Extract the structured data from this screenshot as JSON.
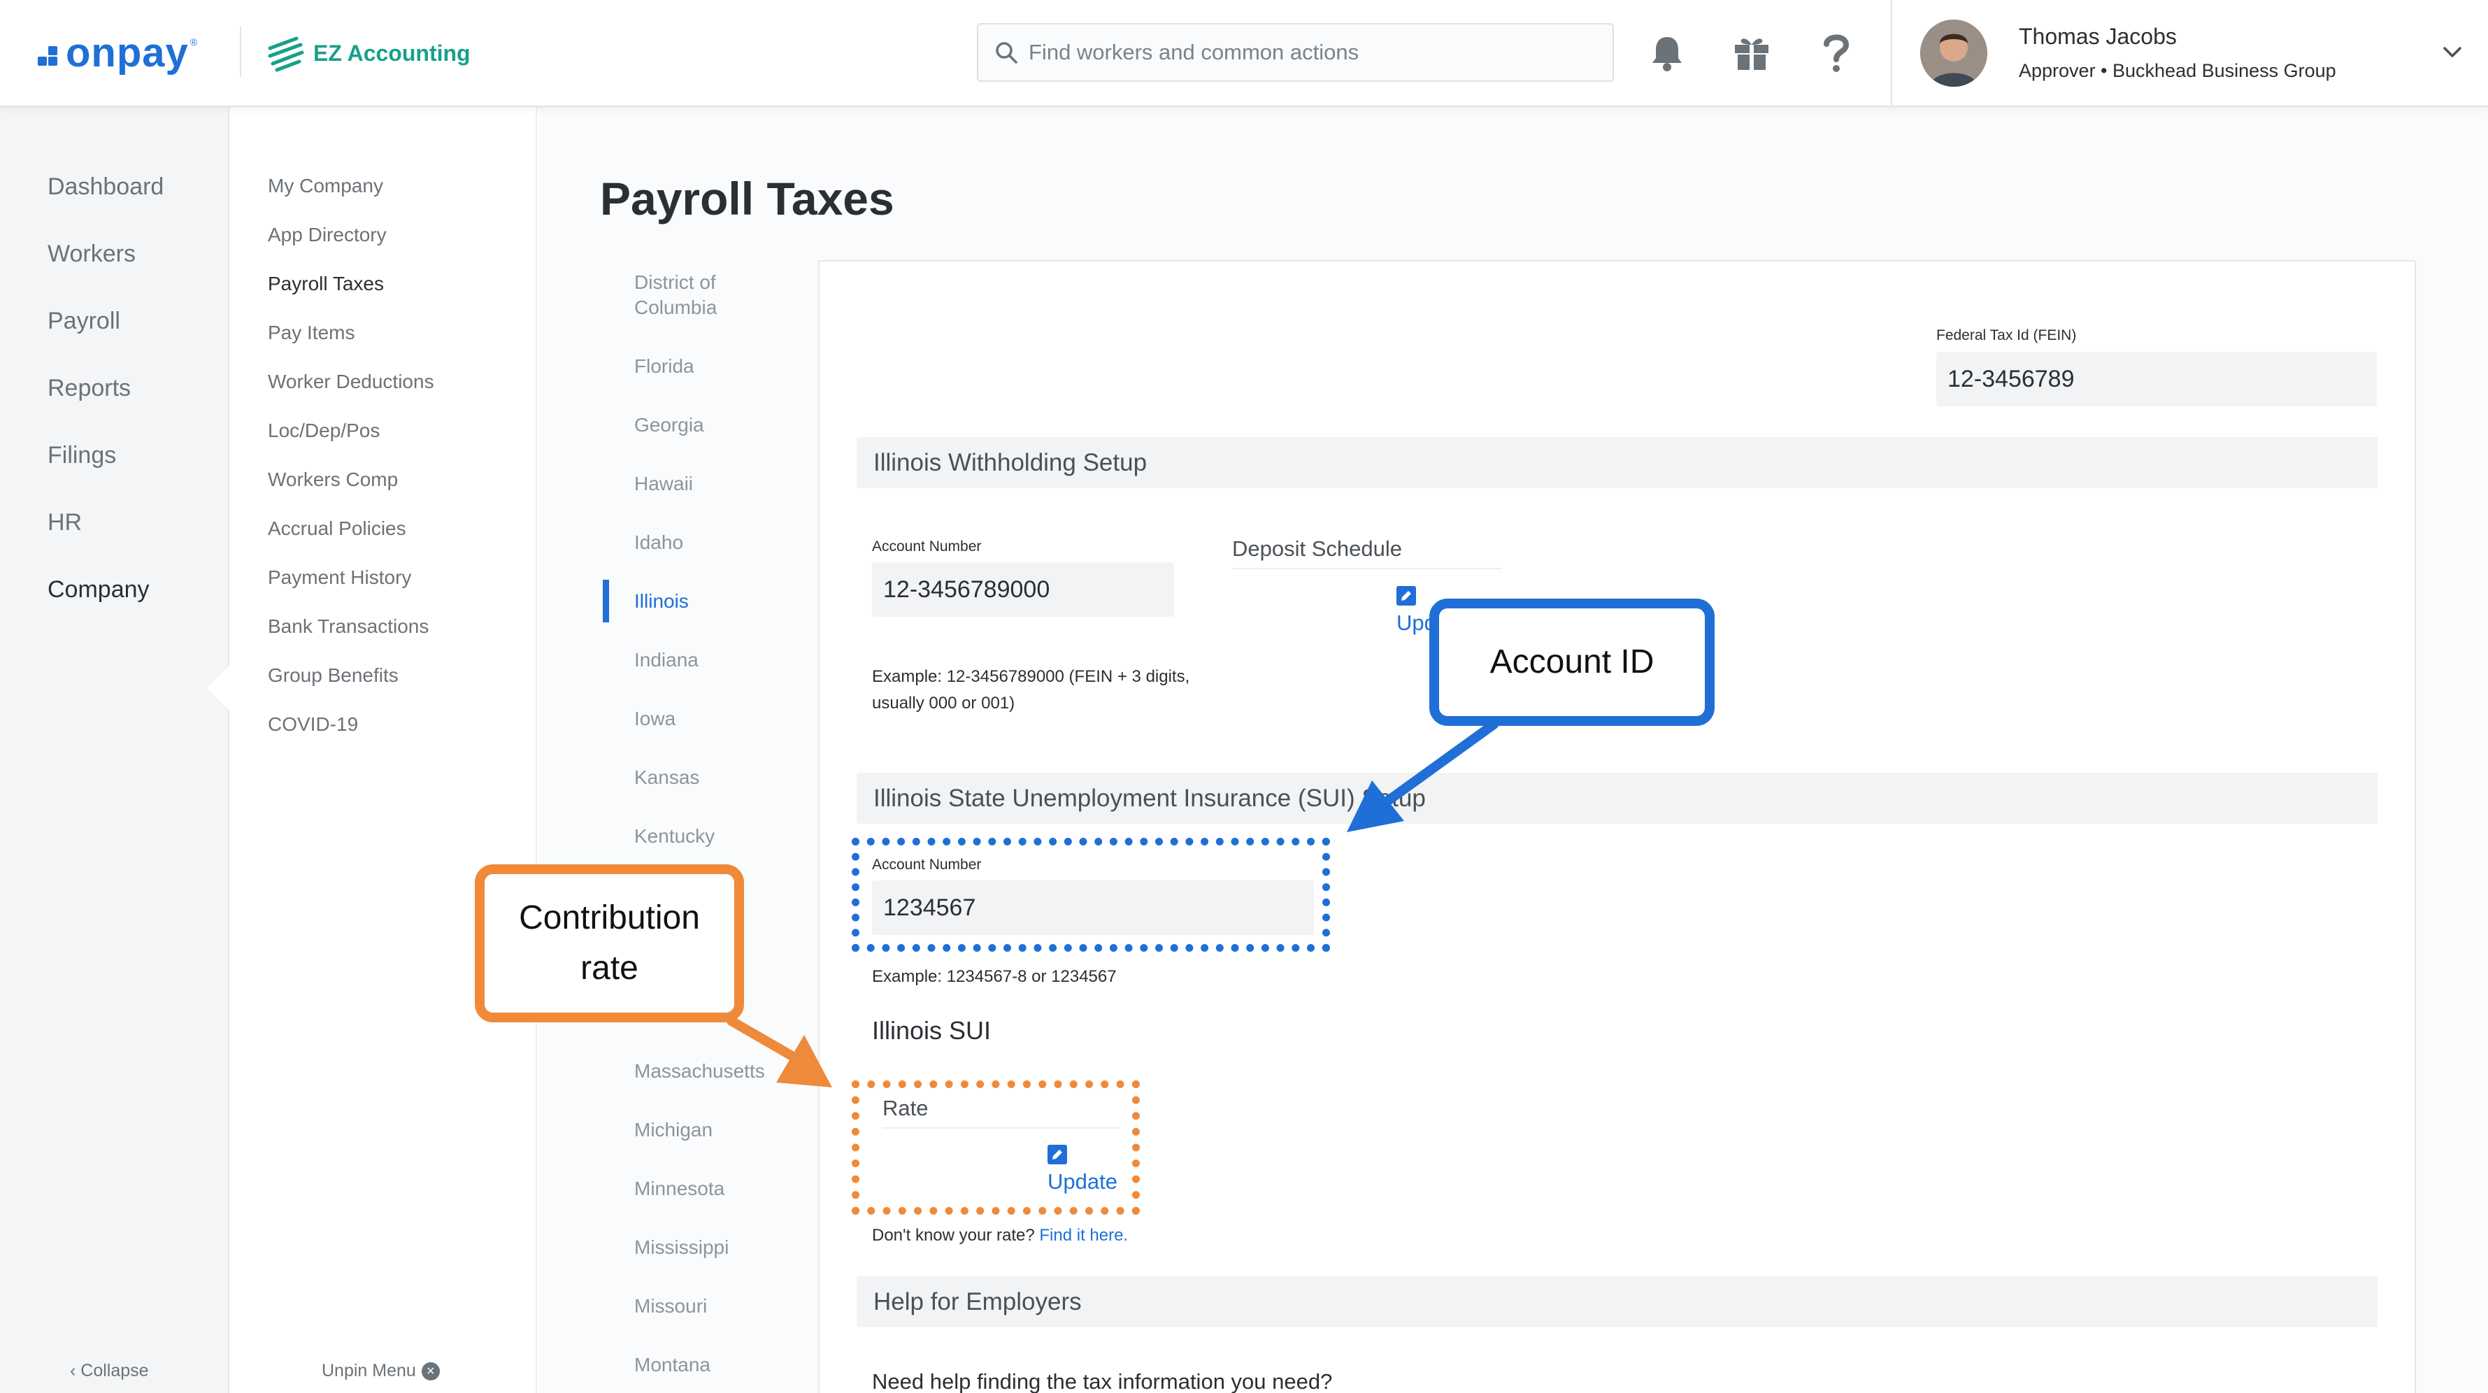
{
  "brand": {
    "logo_text": "onpay",
    "logo_reg": "®",
    "partner": "EZ Accounting"
  },
  "search": {
    "placeholder": "Find workers and common actions"
  },
  "user": {
    "name": "Thomas Jacobs",
    "role": "Approver • Buckhead Business Group"
  },
  "leftnav": {
    "items": [
      {
        "label": "Dashboard"
      },
      {
        "label": "Workers"
      },
      {
        "label": "Payroll"
      },
      {
        "label": "Reports"
      },
      {
        "label": "Filings"
      },
      {
        "label": "HR"
      },
      {
        "label": "Company",
        "active": true
      }
    ],
    "collapse": "Collapse"
  },
  "subnav": {
    "items": [
      {
        "label": "My Company"
      },
      {
        "label": "App Directory"
      },
      {
        "label": "Payroll Taxes",
        "active": true
      },
      {
        "label": "Pay Items"
      },
      {
        "label": "Worker Deductions"
      },
      {
        "label": "Loc/Dep/Pos"
      },
      {
        "label": "Workers Comp"
      },
      {
        "label": "Accrual Policies"
      },
      {
        "label": "Payment History"
      },
      {
        "label": "Bank Transactions"
      },
      {
        "label": "Group Benefits"
      },
      {
        "label": "COVID-19"
      }
    ],
    "unpin": "Unpin Menu"
  },
  "page": {
    "title": "Payroll Taxes"
  },
  "states": [
    {
      "label": "District of\nColumbia"
    },
    {
      "label": "Florida"
    },
    {
      "label": "Georgia"
    },
    {
      "label": "Hawaii"
    },
    {
      "label": "Idaho"
    },
    {
      "label": "Illinois",
      "active": true
    },
    {
      "label": "Indiana"
    },
    {
      "label": "Iowa"
    },
    {
      "label": "Kansas"
    },
    {
      "label": "Kentucky"
    },
    {
      "label": "Massachusetts"
    },
    {
      "label": "Michigan"
    },
    {
      "label": "Minnesota"
    },
    {
      "label": "Mississippi"
    },
    {
      "label": "Missouri"
    },
    {
      "label": "Montana"
    }
  ],
  "fein": {
    "label": "Federal Tax Id (FEIN)",
    "value": "12-3456789"
  },
  "withholding": {
    "heading": "Illinois Withholding Setup",
    "account_label": "Account Number",
    "account_value": "12-3456789000",
    "example": "Example: 12-3456789000 (FEIN + 3 digits, usually 000 or 001)",
    "deposit_label": "Deposit Schedule",
    "deposit_update": "Update"
  },
  "sui": {
    "heading": "Illinois State Unemployment Insurance (SUI) Setup",
    "account_label": "Account Number",
    "account_value": "1234567",
    "example": "Example: 1234567-8 or 1234567",
    "rate_heading": "Illinois SUI",
    "rate_label": "Rate",
    "rate_update": "Update",
    "rate_hint": "Don't know your rate?",
    "rate_hint_link": "Find it here."
  },
  "help": {
    "heading": "Help for Employers",
    "question": "Need help finding the tax information you need?"
  },
  "annotations": {
    "account_id": "Account ID",
    "contribution_rate": "Contribution rate"
  },
  "colors": {
    "brand_blue": "#1f6fd6",
    "ez_green": "#17a08c",
    "callout_orange": "#ef8a3a"
  },
  "icons": [
    "search-icon",
    "bell-icon",
    "gift-icon",
    "help-icon",
    "chevron-down-icon",
    "edit-icon",
    "close-circle-icon",
    "chevron-left-icon"
  ]
}
